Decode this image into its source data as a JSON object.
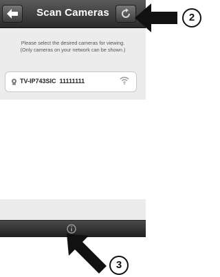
{
  "navbar": {
    "title": "Scan Cameras",
    "back_icon": "back-arrow-icon",
    "refresh_icon": "refresh-icon"
  },
  "instructions": {
    "line1": "Please select the desired cameras for viewing.",
    "line2": "(Only cameras on your network can be shown.)"
  },
  "cameras": [
    {
      "name": "TV-IP743SIC  11111111",
      "icon": "camera-icon",
      "signal_icon": "wifi-icon"
    }
  ],
  "bottom_bar": {
    "info_icon": "info-icon"
  },
  "callouts": {
    "one": "2",
    "two": "3"
  },
  "colors": {
    "navbar": "#3a3a3a",
    "background": "#ececec",
    "arrow": "#111111"
  }
}
